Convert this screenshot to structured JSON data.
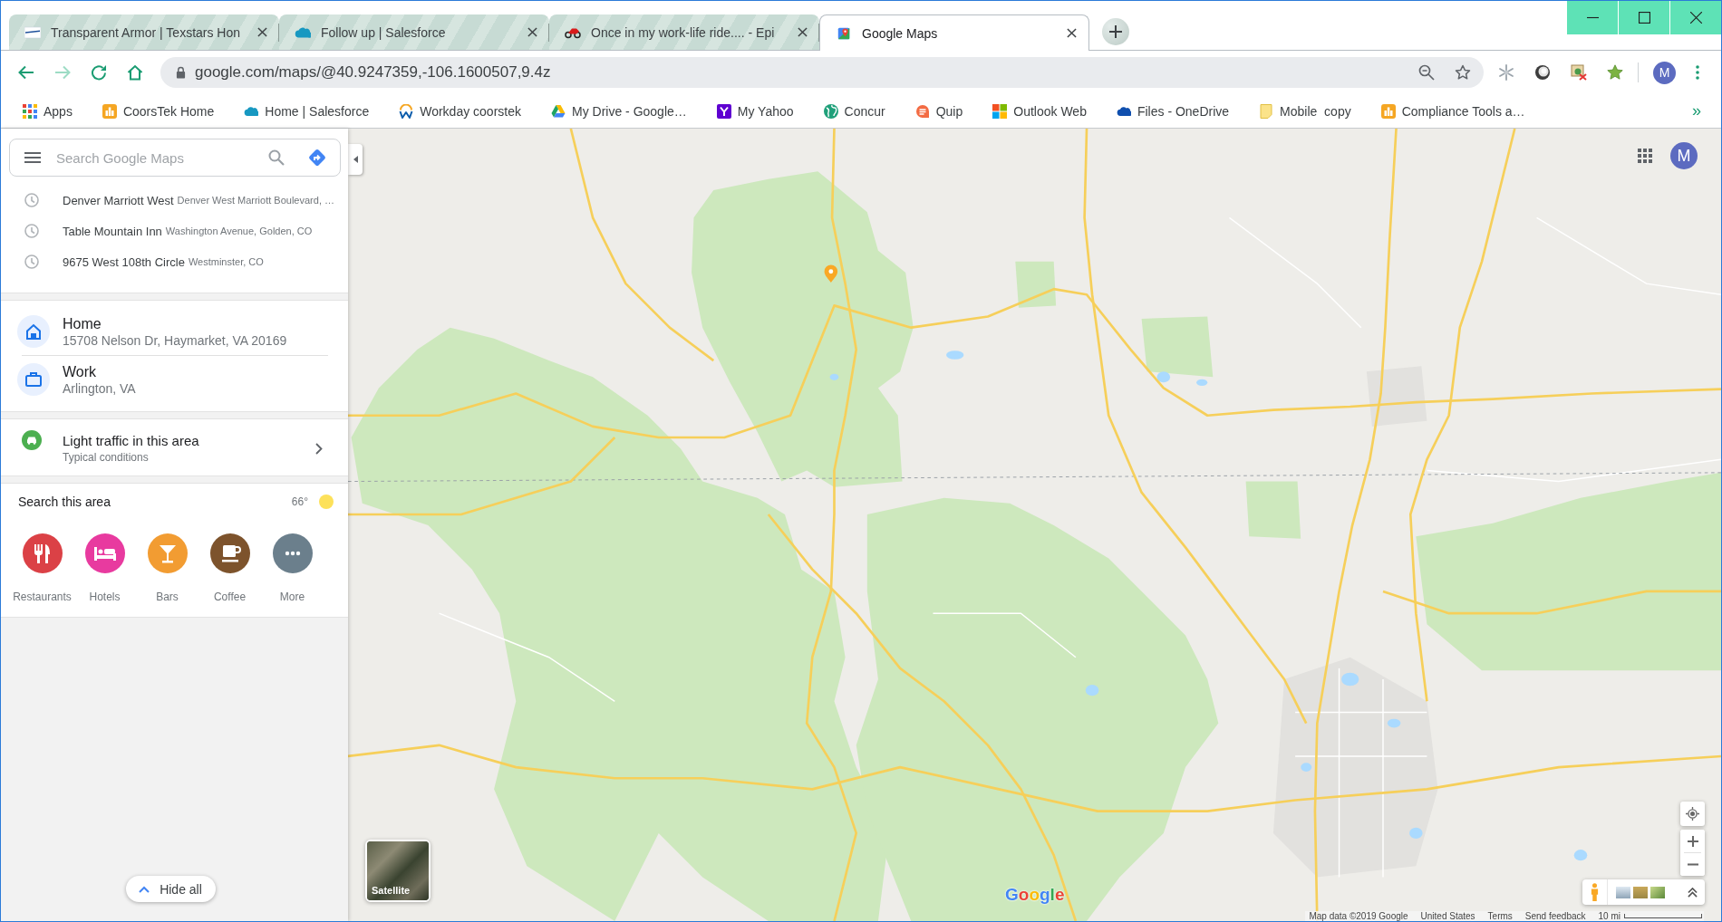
{
  "browser": {
    "tabs": [
      {
        "title": "Transparent Armor | Texstars Hon",
        "kind": "armor",
        "selected": false
      },
      {
        "title": "Follow up | Salesforce",
        "kind": "cloud",
        "selected": false
      },
      {
        "title": "Once in my work-life ride.... - Epi",
        "kind": "motorcycle",
        "selected": false
      },
      {
        "title": "Google Maps",
        "kind": "maps",
        "selected": true
      }
    ],
    "nav": [
      {
        "kind": "back",
        "disabled": false
      },
      {
        "kind": "forward",
        "disabled": true
      },
      {
        "kind": "reload",
        "disabled": false
      },
      {
        "kind": "home",
        "disabled": false
      }
    ],
    "address": "google.com/maps/@40.9247359,-106.1600507,9.4z",
    "profile_initial": "M",
    "bookmarks": [
      {
        "label": "Apps",
        "kind": "apps"
      },
      {
        "label": "CoorsTek Home",
        "kind": "tower"
      },
      {
        "label": "Home | Salesforce",
        "kind": "cloud"
      },
      {
        "label": "Workday coorstek",
        "kind": "workday"
      },
      {
        "label": "My Drive - Google…",
        "kind": "drive"
      },
      {
        "label": "My Yahoo",
        "kind": "yahoo"
      },
      {
        "label": "Concur",
        "kind": "globe"
      },
      {
        "label": "Quip",
        "kind": "quip"
      },
      {
        "label": "Outlook Web",
        "kind": "windows"
      },
      {
        "label": "Files - OneDrive",
        "kind": "onedrive"
      },
      {
        "label": "Mobile  copy",
        "kind": "note"
      },
      {
        "label": "Compliance Tools a…",
        "kind": "tower"
      }
    ],
    "bookmarks_overflow": "»"
  },
  "sidebar": {
    "search": {
      "placeholder": "Search Google Maps"
    },
    "recent": [
      {
        "name": "Denver Marriott West",
        "address": "Denver West Marriott Boulevard, …"
      },
      {
        "name": "Table Mountain Inn",
        "address": "Washington Avenue, Golden, CO"
      },
      {
        "name": "9675 West 108th Circle",
        "address": "Westminster, CO"
      }
    ],
    "places": [
      {
        "kind": "home",
        "label": "Home",
        "address": "15708 Nelson Dr, Haymarket, VA 20169"
      },
      {
        "kind": "work",
        "label": "Work",
        "address": "Arlington, VA"
      }
    ],
    "traffic": {
      "title": "Light traffic in this area",
      "subtitle": "Typical conditions"
    },
    "search_area": {
      "title": "Search this area",
      "temperature": "66°",
      "categories": [
        {
          "kind": "restaurants",
          "label": "Restaurants",
          "color": "#db4146"
        },
        {
          "kind": "hotels",
          "label": "Hotels",
          "color": "#e83a9f"
        },
        {
          "kind": "bars",
          "label": "Bars",
          "color": "#f29c32"
        },
        {
          "kind": "coffee",
          "label": "Coffee",
          "color": "#7d532c"
        },
        {
          "kind": "more",
          "label": "More",
          "color": "#6b7f8c"
        }
      ]
    },
    "hide_all": "Hide all"
  },
  "map": {
    "account_initial": "M",
    "layer_toggle": "Satellite",
    "logo": "Google",
    "copyright": "Map data ©2019 Google",
    "links": [
      "United States",
      "Terms",
      "Send feedback"
    ],
    "scale": "10 mi"
  }
}
